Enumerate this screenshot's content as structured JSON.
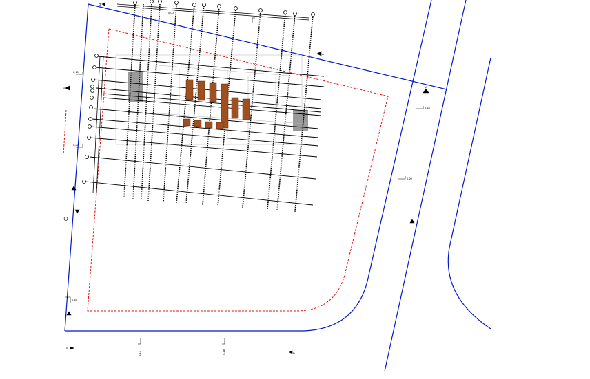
{
  "colors": {
    "background": "#ffffff",
    "street_line": "#0018c8",
    "site_boundary": "#e01010",
    "grid_line": "#000000",
    "building_block": "#a0501e",
    "faint_plan": "#9a9a9a"
  },
  "labels": {
    "top_section": "B",
    "section_a_top": "A",
    "section_right": "A",
    "level_right_1": "0,18",
    "level_right_2": "0,20",
    "level_left_1": "0,10",
    "level_left_2": "0,20",
    "level_bottom_left": "0,16",
    "bottom_mark_1": "0-17",
    "bottom_mark_2": "0-18",
    "bottom_letter_a": "A",
    "bottom_letter_b": "B",
    "misc_tag_1": "0-00",
    "misc_tag_2": "0.00"
  },
  "icons": [
    "section-arrow-icon",
    "grid-bubble-icon",
    "level-marker-icon"
  ]
}
